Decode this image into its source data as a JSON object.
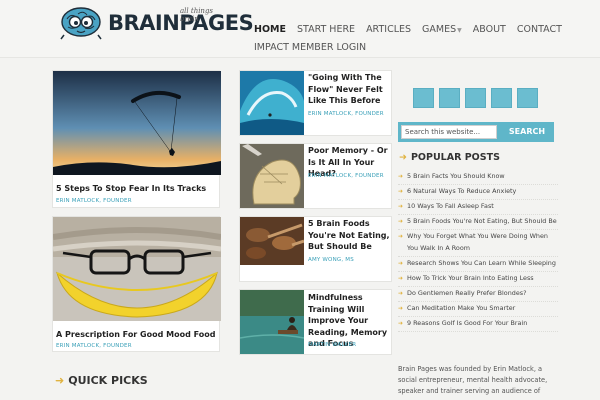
{
  "site": {
    "logo": {
      "brand_text": "BRAINPAGES",
      "tagline": "all things brain"
    },
    "nav": {
      "items": [
        {
          "label": "HOME",
          "active": true,
          "has_dropdown": false
        },
        {
          "label": "START HERE",
          "active": false,
          "has_dropdown": false
        },
        {
          "label": "ARTICLES",
          "active": false,
          "has_dropdown": false
        },
        {
          "label": "GAMES",
          "active": false,
          "has_dropdown": true
        },
        {
          "label": "ABOUT",
          "active": false,
          "has_dropdown": false
        },
        {
          "label": "CONTACT",
          "active": false,
          "has_dropdown": false
        },
        {
          "label": "IMPACT MEMBER LOGIN",
          "active": false,
          "has_dropdown": false
        }
      ]
    }
  },
  "featured": [
    {
      "title": "5 Steps To Stop Fear In Its Tracks",
      "author": "ERIN MATLOCK, FOUNDER",
      "image": "paraglider-sunset"
    },
    {
      "title": "A Prescription For Good Mood Food",
      "author": "ERIN MATLOCK, FOUNDER",
      "image": "banana-glasses"
    }
  ],
  "articles": [
    {
      "title": "\"Going With The Flow\" Never Felt Like This Before",
      "author": "ERIN MATLOCK, FOUNDER",
      "image": "surfer-wave"
    },
    {
      "title": "Poor Memory - Or Is It All In Your Head?",
      "author": "ERIN MATLOCK, FOUNDER",
      "image": "phrenology-head"
    },
    {
      "title": "5 Brain Foods You're Not Eating, But Should Be",
      "author": "AMY WONG, MS",
      "image": "spoons-spices"
    },
    {
      "title": "Mindfulness Training Will Improve Your Reading, Memory and Focus",
      "author": "MARTIN WALKER",
      "image": "meditation-water"
    }
  ],
  "quick_picks": {
    "label": "QUICK PICKS"
  },
  "sidebar": {
    "social_icons": [
      "facebook-icon",
      "twitter-icon",
      "google-plus-icon",
      "pinterest-icon",
      "rss-icon"
    ],
    "search": {
      "placeholder": "Search this website...",
      "button_label": "SEARCH"
    },
    "popular": {
      "heading": "POPULAR POSTS",
      "items": [
        "5 Brain Facts You Should Know",
        "6 Natural Ways To Reduce Anxiety",
        "10 Ways To Fall Asleep Fast",
        "5 Brain Foods You're Not Eating, But Should Be",
        "Why You Forget What You Were Doing When You Walk In A Room",
        "Research Shows You Can Learn While Sleeping",
        "How To Trick Your Brain Into Eating Less",
        "Do Gentlemen Really Prefer Blondes?",
        "Can Meditation Make You Smarter",
        "9 Reasons Golf Is Good For Your Brain"
      ]
    },
    "about": "Brain Pages was founded by Erin Matlock, a social entrepreneur, mental health advocate, speaker and trainer serving an audience of"
  },
  "colors": {
    "accent": "#5fb6c9",
    "bullet": "#e0b341",
    "author": "#3aa0b8"
  }
}
